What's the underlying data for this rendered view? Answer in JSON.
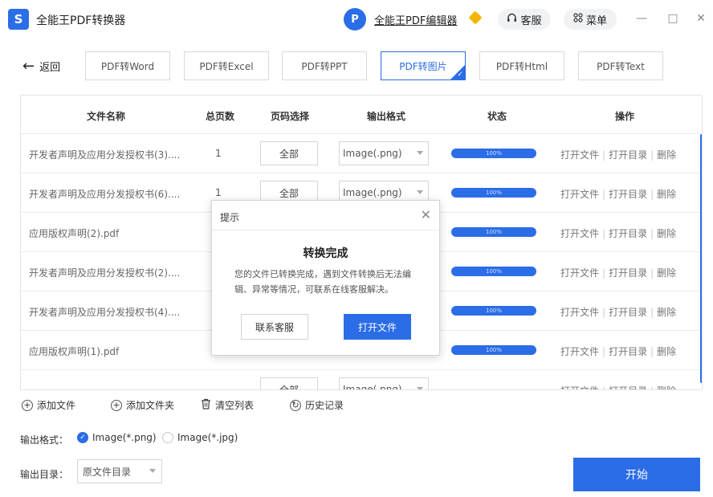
{
  "titlebar": {
    "logo_text": "S",
    "title": "全能王PDF转换器",
    "editor_logo_text": "P",
    "editor_link": "全能王PDF编辑器",
    "service_icon": "headset-icon",
    "service_label": "客服",
    "menu_icon": "grid-icon",
    "menu_label": "菜单",
    "minimize": "—",
    "maximize": "□",
    "close": "✕"
  },
  "nav": {
    "back_arrow": "←",
    "back_label": "返回",
    "tabs": [
      {
        "label": "PDF转Word"
      },
      {
        "label": "PDF转Excel"
      },
      {
        "label": "PDF转PPT"
      },
      {
        "label": "PDF转图片",
        "active": true
      },
      {
        "label": "PDF转Html"
      },
      {
        "label": "PDF转Text"
      }
    ]
  },
  "table": {
    "headers": {
      "name": "文件名称",
      "pages": "总页数",
      "range": "页码选择",
      "format": "输出格式",
      "status": "状态",
      "ops": "操作"
    },
    "rows": [
      {
        "name": "开发者声明及应用分发授权书(3)....",
        "pages": "1",
        "range": "全部",
        "format": "Image(.png)",
        "progress": "100%"
      },
      {
        "name": "开发者声明及应用分发授权书(6)....",
        "pages": "1",
        "range": "全部",
        "format": "Image(.png)",
        "progress": "100%"
      },
      {
        "name": "应用版权声明(2).pdf",
        "pages": "",
        "range": "",
        "format": "",
        "progress": "100%"
      },
      {
        "name": "开发者声明及应用分发授权书(2)....",
        "pages": "",
        "range": "",
        "format": "",
        "progress": "100%"
      },
      {
        "name": "开发者声明及应用分发授权书(4)....",
        "pages": "",
        "range": "",
        "format": "",
        "progress": "100%"
      },
      {
        "name": "应用版权声明(1).pdf",
        "pages": "",
        "range": "",
        "format": "",
        "progress": "100%"
      },
      {
        "name": "",
        "pages": "",
        "range": "全部",
        "format": "Image(.png)",
        "progress": ""
      }
    ],
    "op_open_file": "打开文件",
    "op_open_dir": "打开目录",
    "op_delete": "删除",
    "op_sep": "|"
  },
  "dialog": {
    "title": "提示",
    "close": "✕",
    "heading": "转换完成",
    "message": "您的文件已转换完成，遇到文件转换后无法编辑、异常等情况，可联系在线客服解决。",
    "contact_btn": "联系客服",
    "open_btn": "打开文件"
  },
  "actions": {
    "add_file": "添加文件",
    "add_folder": "添加文件夹",
    "clear_list": "清空列表",
    "history": "历史记录",
    "plus_glyph": "+",
    "trash_glyph": "🗑",
    "history_glyph": "↻"
  },
  "output": {
    "format_label": "输出格式：",
    "opt_png": "Image(*.png)",
    "opt_jpg": "Image(*.jpg)",
    "dir_label": "输出目录：",
    "dir_value": "原文件目录",
    "check": "✓"
  },
  "start_label": "开始",
  "colors": {
    "accent": "#2b6de6"
  }
}
